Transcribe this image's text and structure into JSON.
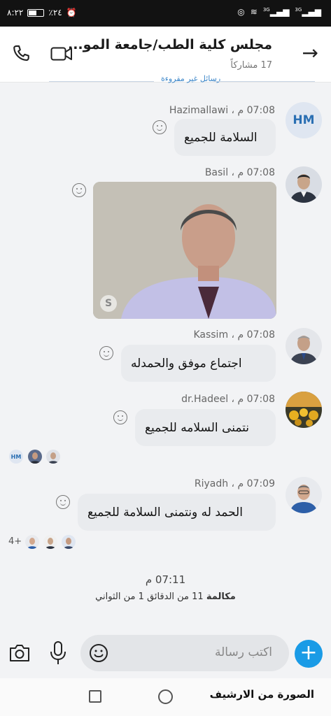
{
  "status": {
    "time": "٨:٢٢",
    "battery": "٪٢٤",
    "signal_1": "3G",
    "signal_2": "3G"
  },
  "header": {
    "title": "مجلس كلية الطب/جامعة المو...",
    "participants": "17 مشاركاً"
  },
  "unread_divider": "رسائل غير مقروءة",
  "messages": [
    {
      "sender": "Hazimallawi",
      "time": "07:08 م ،",
      "text": "السلامة للجميع",
      "avatar_initials": "HM"
    },
    {
      "sender": "Basil",
      "time": "07:08 م ،",
      "type": "image"
    },
    {
      "sender": "Kassim",
      "time": "07:08 م ،",
      "text": "اجتماع موفق والحمدله"
    },
    {
      "sender": "dr.Hadeel",
      "time": "07:08 م ،",
      "text": "نتمنى السلامه للجميع"
    },
    {
      "sender": "Riyadh",
      "time": "07:09 م ،",
      "text": "الحمد له ونتمنى السلامة للجميع"
    }
  ],
  "read_receipts_1": {
    "initials": "HM"
  },
  "read_receipts_2": {
    "more": "4+"
  },
  "call": {
    "time": "07:11 م",
    "label": "مكالمة",
    "duration": "11 من الدقائق 1 من الثواني"
  },
  "composer": {
    "placeholder": "اكتب رسالة"
  },
  "watermark": "الصورة من الارشيف",
  "colors": {
    "accent": "#1a9be6",
    "bubble": "#e9ebee",
    "background": "#f2f3f5"
  }
}
